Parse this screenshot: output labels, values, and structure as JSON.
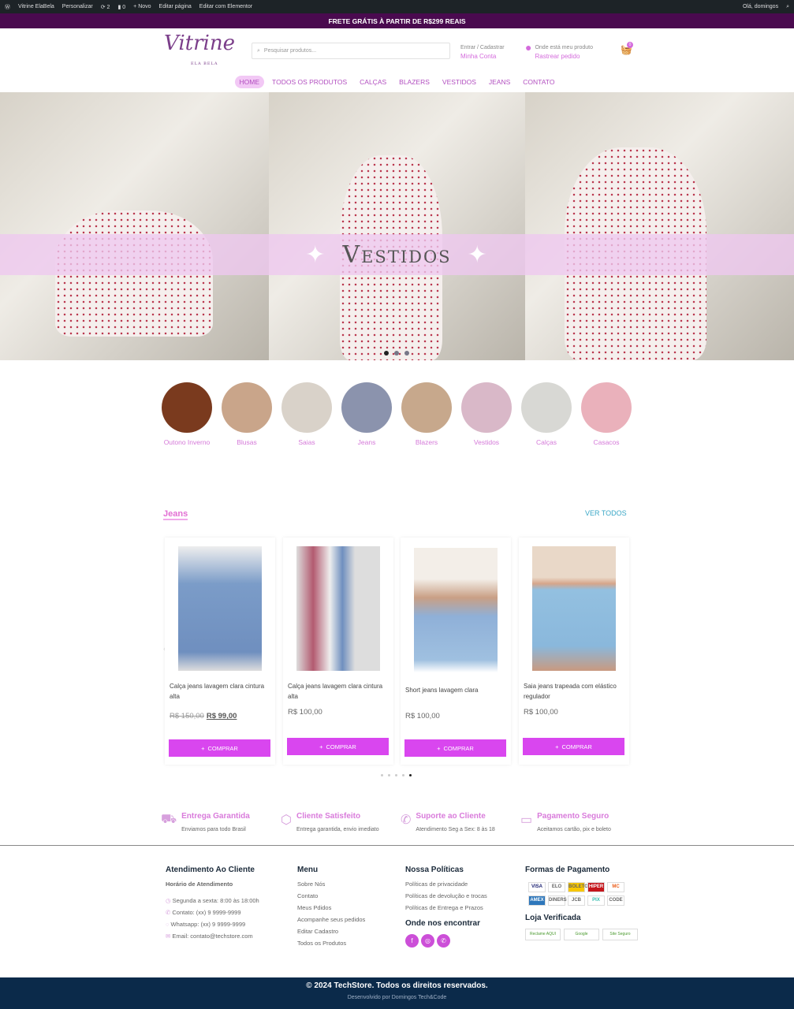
{
  "admin_bar": {
    "site": "Vitrine ElaBela",
    "customize": "Personalizar",
    "updates": "2",
    "comments": "0",
    "new": "Novo",
    "edit_page": "Editar página",
    "elementor": "Editar com Elementor",
    "greeting": "Olá, domingos"
  },
  "promo": "FRETE GRÁTIS À PARTIR DE R$299 REAIS",
  "header": {
    "logo_text": "Vitrine",
    "logo_sub": "ELA BELA",
    "search_placeholder": "Pesquisar produtos...",
    "account_top": "Entrar / Cadastrar",
    "account_link": "Minha Conta",
    "track_top": "Onde está meu produto",
    "track_link": "Rastrear pedido",
    "cart_count": "0"
  },
  "nav": [
    "HOME",
    "TODOS OS PRODUTOS",
    "CALÇAS",
    "BLAZERS",
    "VESTIDOS",
    "JEANS",
    "CONTATO"
  ],
  "hero": {
    "title": "Vestidos",
    "slides": 3,
    "active_slide": 1
  },
  "categories": [
    "Outono Inverno",
    "Blusas",
    "Saias",
    "Jeans",
    "Blazers",
    "Vestidos",
    "Calças",
    "Casacos"
  ],
  "section": {
    "title": "Jeans",
    "see_all": "VER TODOS"
  },
  "products": [
    {
      "name": "Calça jeans lavagem clara cintura alta",
      "old_price": "R$ 150,00",
      "price": "R$ 99,00",
      "button": "COMPRAR"
    },
    {
      "name": "Calça jeans lavagem clara cintura alta",
      "price": "R$ 100,00",
      "button": "COMPRAR"
    },
    {
      "name": "Short jeans lavagem clara",
      "price": "R$ 100,00",
      "button": "COMPRAR"
    },
    {
      "name": "Saia jeans trapeada com elástico regulador",
      "price": "R$ 100,00",
      "button": "COMPRAR"
    }
  ],
  "carousel": {
    "pages": 5,
    "active": 5
  },
  "features": [
    {
      "icon": "truck-icon",
      "title": "Entrega Garantida",
      "text": "Enviamos para todo Brasil"
    },
    {
      "icon": "box-icon",
      "title": "Cliente Satisfeito",
      "text": "Entrega garantida, envio imediato"
    },
    {
      "icon": "phone-icon",
      "title": "Suporte ao Cliente",
      "text": "Atendimento Seg a Sex: 8 às 18"
    },
    {
      "icon": "credit-card-icon",
      "title": "Pagamento Seguro",
      "text": "Aceitamos cartão, pix e boleto"
    }
  ],
  "footer": {
    "service": {
      "title": "Atendimento Ao Cliente",
      "subtitle": "Horário de Atendimento",
      "items": [
        "Segunda a sexta: 8:00 às 18:00h",
        "Contato: (xx) 9 9999-9999",
        "Whatsapp: (xx) 9 9999-9999",
        "Email: contato@techstore.com"
      ]
    },
    "menu": {
      "title": "Menu",
      "items": [
        "Sobre Nós",
        "Contato",
        "Meus Pdidos",
        "Acompanhe seus pedidos",
        "Editar Cadastro",
        "Todos os Produtos"
      ]
    },
    "policies": {
      "title": "Nossa Políticas",
      "items": [
        "Políticas de privacidade",
        "Políticas de devolução e trocas",
        "Políticas de Entrega e Prazos"
      ],
      "find_title": "Onde nos encontrar"
    },
    "payment": {
      "title": "Formas de Pagamento",
      "methods": [
        "VISA",
        "ELO",
        "BOLETO",
        "HIPER",
        "MC",
        "AMEX",
        "DINERS",
        "JCB",
        "PIX",
        "CODE"
      ],
      "verified_title": "Loja Verificada",
      "seals": [
        "Reclame AQUI",
        "Google",
        "Site Seguro"
      ]
    },
    "copyright": "© 2024 TechStore. Todos os direitos reservados.",
    "developer": "Desenvolvido por Domingos Tech&Code"
  },
  "colors": {
    "accent": "#d946ef",
    "promo_bg": "#4a0a4f",
    "footer_bg": "#0b2a4a",
    "link": "#3aa7c6"
  }
}
